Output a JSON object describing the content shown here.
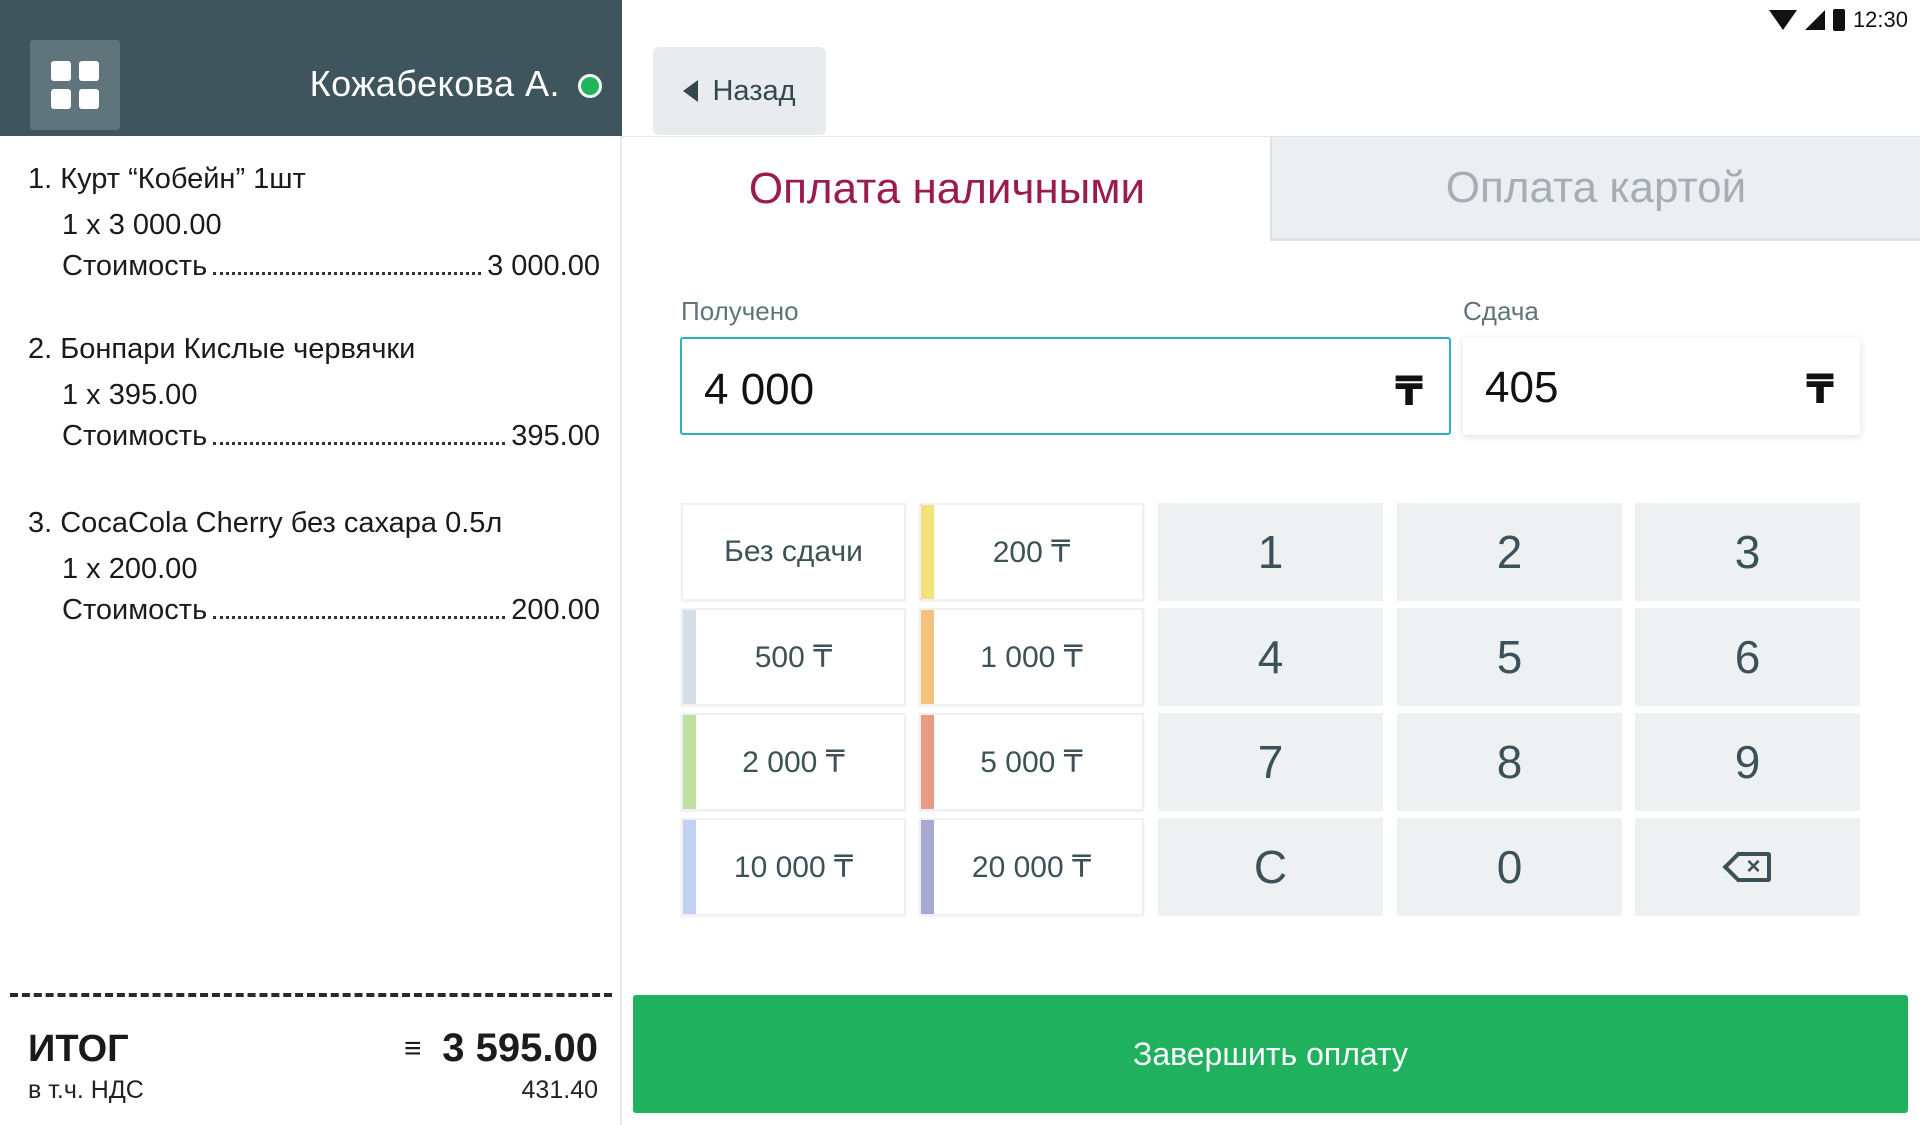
{
  "statusbar": {
    "time": "12:30",
    "icons": [
      "wifi-icon",
      "signal-icon",
      "battery-icon"
    ]
  },
  "header": {
    "cashier_name": "Кожабекова А.",
    "menu_icon": "grid-icon",
    "status_color": "#22b45a"
  },
  "receipt": {
    "items": [
      {
        "name": "1. Курт “Кобейн” 1шт",
        "qty_line": "1 x 3 000.00",
        "cost_label": "Стоимость",
        "cost": "3 000.00"
      },
      {
        "name": "2. Бонпари Кислые червячки",
        "qty_line": "1 x 395.00",
        "cost_label": "Стоимость",
        "cost": "395.00"
      },
      {
        "name": "3. CocaCola Cherry без сахара 0.5л",
        "qty_line": "1 x 200.00",
        "cost_label": "Стоимость",
        "cost": "200.00"
      }
    ],
    "total_label": "ИТОГ",
    "total_symbol": "≡",
    "total_value": "3 595.00",
    "vat_label": "в т.ч. НДС",
    "vat_value": "431.40"
  },
  "nav": {
    "back_label": "Назад"
  },
  "tabs": {
    "cash": "Оплата наличными",
    "card": "Оплата картой",
    "active": "cash"
  },
  "payment": {
    "received_label": "Получено",
    "received_value": "4 000",
    "change_label": "Сдача",
    "change_value": "405",
    "currency": "₸"
  },
  "quick_buttons": [
    {
      "label": "Без сдачи",
      "color": ""
    },
    {
      "label": "200 ₸",
      "color": "#f4e27a"
    },
    {
      "label": "500 ₸",
      "color": "#d7dde6"
    },
    {
      "label": "1 000 ₸",
      "color": "#f5c27e"
    },
    {
      "label": "2 000 ₸",
      "color": "#bfe0a0"
    },
    {
      "label": "5 000 ₸",
      "color": "#e99b85"
    },
    {
      "label": "10 000 ₸",
      "color": "#c2d0f2"
    },
    {
      "label": "20 000 ₸",
      "color": "#a9a8d2"
    }
  ],
  "keypad": [
    "1",
    "2",
    "3",
    "4",
    "5",
    "6",
    "7",
    "8",
    "9",
    "C",
    "0",
    "backspace"
  ],
  "actions": {
    "finish_label": "Завершить оплату"
  },
  "colors": {
    "accent": "#9b1b4f",
    "primary": "#1fb15d",
    "header_bg": "#3f555d",
    "input_border": "#2ab0bf"
  }
}
